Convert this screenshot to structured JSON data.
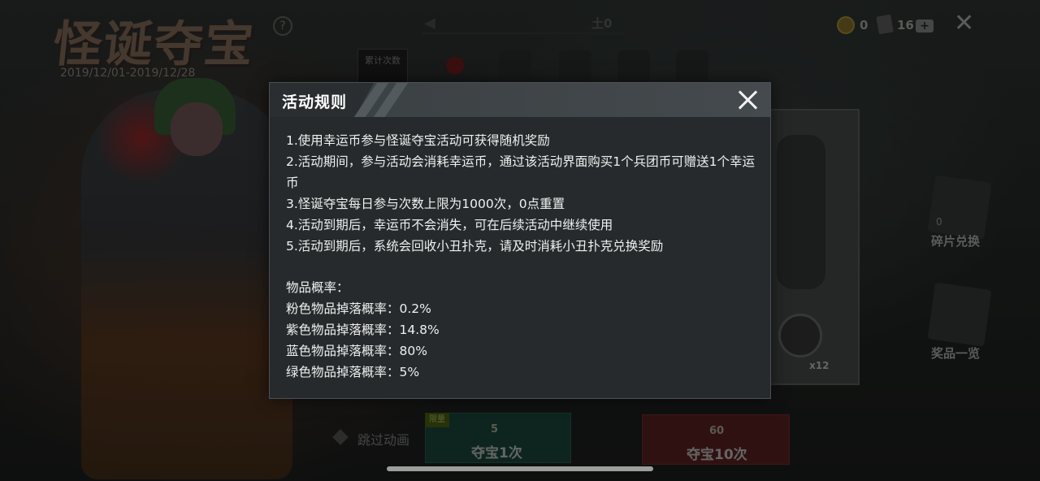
{
  "background": {
    "event_title": "怪诞夺宝",
    "event_dates": "2019/12/01-2019/12/28",
    "help_glyph": "?",
    "tab_label": "土0",
    "coin_count": "0",
    "card_count": "16",
    "count_label": "累计次数",
    "item_multiplier": "x12",
    "side_items": [
      {
        "label": "碎片兑换",
        "sub": "0"
      },
      {
        "label": "奖品一览"
      }
    ],
    "skip_label": "跳过动画",
    "limited_tag": "限量",
    "draw_once": {
      "cost": "5",
      "label": "夺宝1次"
    },
    "draw_ten": {
      "cost": "60",
      "label": "夺宝10次"
    }
  },
  "modal": {
    "title": "活动规则",
    "rules": [
      "1.使用幸运币参与怪诞夺宝活动可获得随机奖励",
      "2.活动期间，参与活动会消耗幸运币，通过该活动界面购买1个兵团币可赠送1个幸运币",
      "3.怪诞夺宝每日参与次数上限为1000次，0点重置",
      "4.活动到期后，幸运币不会消失，可在后续活动中继续使用",
      "5.活动到期后，系统会回收小丑扑克，请及时消耗小丑扑克兑换奖励"
    ],
    "probability_heading": "物品概率：",
    "probabilities": [
      "粉色物品掉落概率：0.2%",
      "紫色物品掉落概率：14.8%",
      "蓝色物品掉落概率：80%",
      "绿色物品掉落概率：5%"
    ]
  }
}
